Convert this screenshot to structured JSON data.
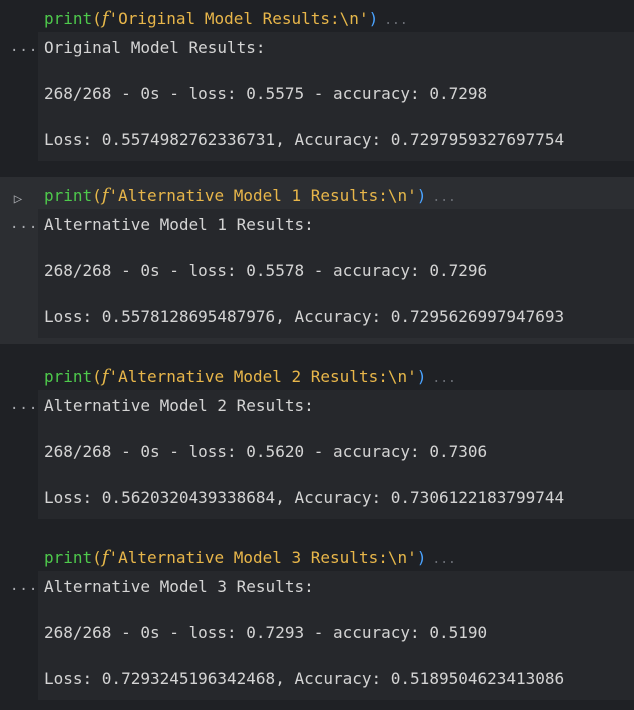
{
  "colors": {
    "background": "#1f2125",
    "active_cell": "#2c2e32",
    "output_bg": "#26282c",
    "function": "#4ec94c",
    "string": "#e8b64a",
    "paren_close": "#4aa3ff"
  },
  "icons": {
    "run": "play-triangle",
    "output_marker": "ellipsis"
  },
  "cells": [
    {
      "code": {
        "fn": "print",
        "open": "(",
        "prefix": "f",
        "string": "'Original Model Results:",
        "escape": "\\n",
        "quote_end": "'",
        "close": ")",
        "more": "..."
      },
      "output_marker": "...",
      "output": [
        "Original Model Results:",
        "268/268 - 0s - loss: 0.5575 - accuracy: 0.7298",
        "Loss: 0.5574982762336731, Accuracy: 0.7297959327697754"
      ]
    },
    {
      "run_icon": "▷",
      "code": {
        "fn": "print",
        "open": "(",
        "prefix": "f",
        "string": "'Alternative Model 1 Results:",
        "escape": "\\n",
        "quote_end": "'",
        "close": ")",
        "more": "..."
      },
      "output_marker": "...",
      "output": [
        "Alternative Model 1 Results:",
        "268/268 - 0s - loss: 0.5578 - accuracy: 0.7296",
        "Loss: 0.5578128695487976, Accuracy: 0.7295626997947693"
      ]
    },
    {
      "code": {
        "fn": "print",
        "open": "(",
        "prefix": "f",
        "string": "'Alternative Model 2 Results:",
        "escape": "\\n",
        "quote_end": "'",
        "close": ")",
        "more": "..."
      },
      "output_marker": "...",
      "output": [
        "Alternative Model 2 Results:",
        "268/268 - 0s - loss: 0.5620 - accuracy: 0.7306",
        "Loss: 0.5620320439338684, Accuracy: 0.7306122183799744"
      ]
    },
    {
      "code": {
        "fn": "print",
        "open": "(",
        "prefix": "f",
        "string": "'Alternative Model 3 Results:",
        "escape": "\\n",
        "quote_end": "'",
        "close": ")",
        "more": "..."
      },
      "output_marker": "...",
      "output": [
        "Alternative Model 3 Results:",
        "268/268 - 0s - loss: 0.7293 - accuracy: 0.5190",
        "Loss: 0.7293245196342468, Accuracy: 0.5189504623413086"
      ]
    }
  ]
}
